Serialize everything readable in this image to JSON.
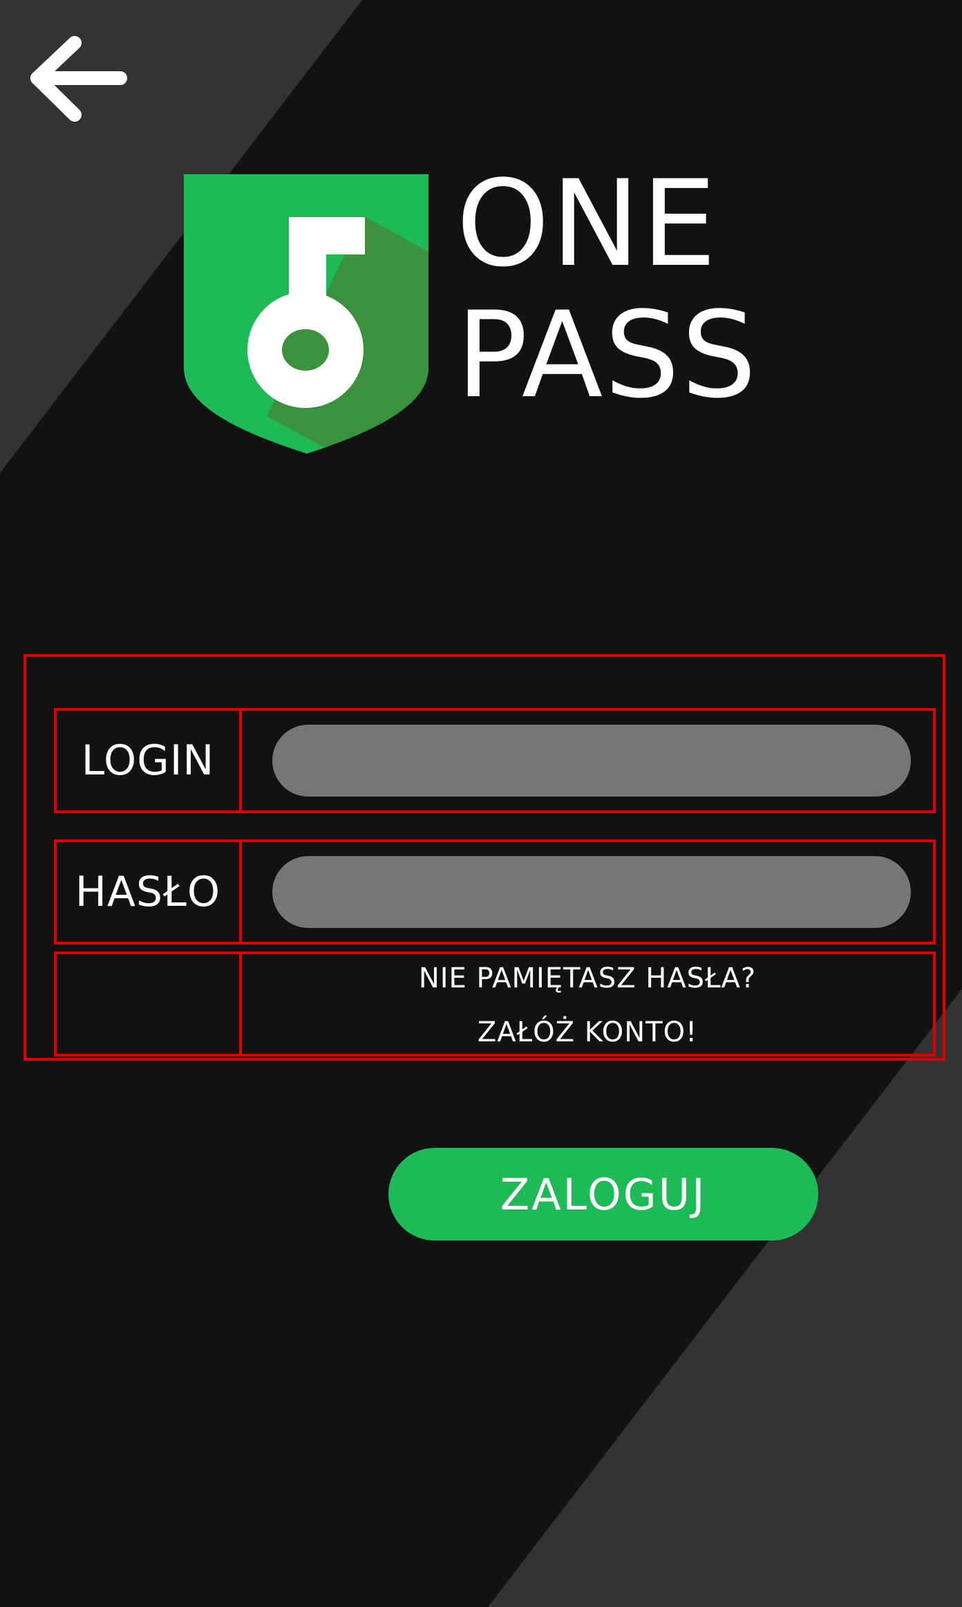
{
  "app": {
    "logo_line_1": "ONE",
    "logo_line_2": "PASS"
  },
  "navigation": {
    "back_icon": "arrow-left-icon"
  },
  "form": {
    "login_label": "LOGIN",
    "login_value": "",
    "password_label": "HASŁO",
    "password_value": "",
    "forgot_password_link": "NIE PAMIĘTASZ HASŁA?",
    "register_link": "ZAŁÓŻ KONTO!"
  },
  "actions": {
    "login_button": "ZALOGUJ"
  },
  "colors": {
    "background": "#121212",
    "background_stripe": "#333333",
    "brand_green": "#1fba58",
    "brand_green_shadow": "#3b913d",
    "input_fill": "#767676",
    "outline_red": "#e00000"
  }
}
